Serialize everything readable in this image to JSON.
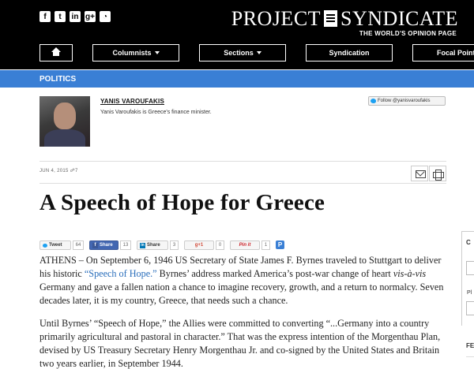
{
  "header": {
    "social_icons": [
      {
        "name": "facebook-icon",
        "glyph": "f"
      },
      {
        "name": "twitter-icon",
        "glyph": "t"
      },
      {
        "name": "linkedin-icon",
        "glyph": "in"
      },
      {
        "name": "google-plus-icon",
        "glyph": "g+"
      },
      {
        "name": "rss-icon",
        "glyph": "◔"
      }
    ],
    "logo_left": "PROJECT",
    "logo_right": "SYNDICATE",
    "tagline": "THE WORLD'S OPINION PAGE",
    "nav": {
      "home_icon": "home-icon",
      "columnists": "Columnists",
      "sections": "Sections",
      "syndication": "Syndication",
      "focal_points": "Focal Points"
    }
  },
  "section": {
    "label": "POLITICS",
    "color": "#3a7fd5"
  },
  "author": {
    "name": "YANIS VAROUFAKIS",
    "bio": "Yanis Varoufakis is Greece's finance minister.",
    "follow": "Follow @yanisvaroufakis"
  },
  "meta": {
    "date": "JUN 4, 2015",
    "comments": "☍7"
  },
  "article": {
    "headline": "A Speech of Hope for Greece",
    "p1_before": "ATHENS – On September 6, 1946 US Secretary of State James F. Byrnes traveled to Stuttgart to deliver his historic ",
    "p1_link": "“Speech of Hope.”",
    "p1_mid": " Byrnes’ address marked America’s post-war change of heart ",
    "p1_italic": "vis-à-vis",
    "p1_after": " Germany and gave a fallen nation a chance to imagine recovery, growth, and a return to normalcy. Seven decades later, it is my country, Greece, that needs such a chance.",
    "p2": "Until Byrnes’ “Speech of Hope,” the Allies were committed to converting “...Germany into a country primarily agricultural and pastoral in character.” That was the express intention of the Morgenthau Plan, devised by US Treasury Secretary Henry Morgenthau Jr. and co-signed by the United States and Britain two years earlier, in September 1944."
  },
  "share": {
    "tweet": "Tweet",
    "tweet_count": "64",
    "facebook": "Share",
    "facebook_count": "13",
    "linkedin": "Share",
    "linkedin_count": "3",
    "gplus": "g+1",
    "gplus_count": "0",
    "pinterest": "Pin it",
    "pinterest_count": "1",
    "extra": "P"
  },
  "sidebar": {
    "c": "C",
    "pl": "Pl",
    "fe": "FE"
  }
}
